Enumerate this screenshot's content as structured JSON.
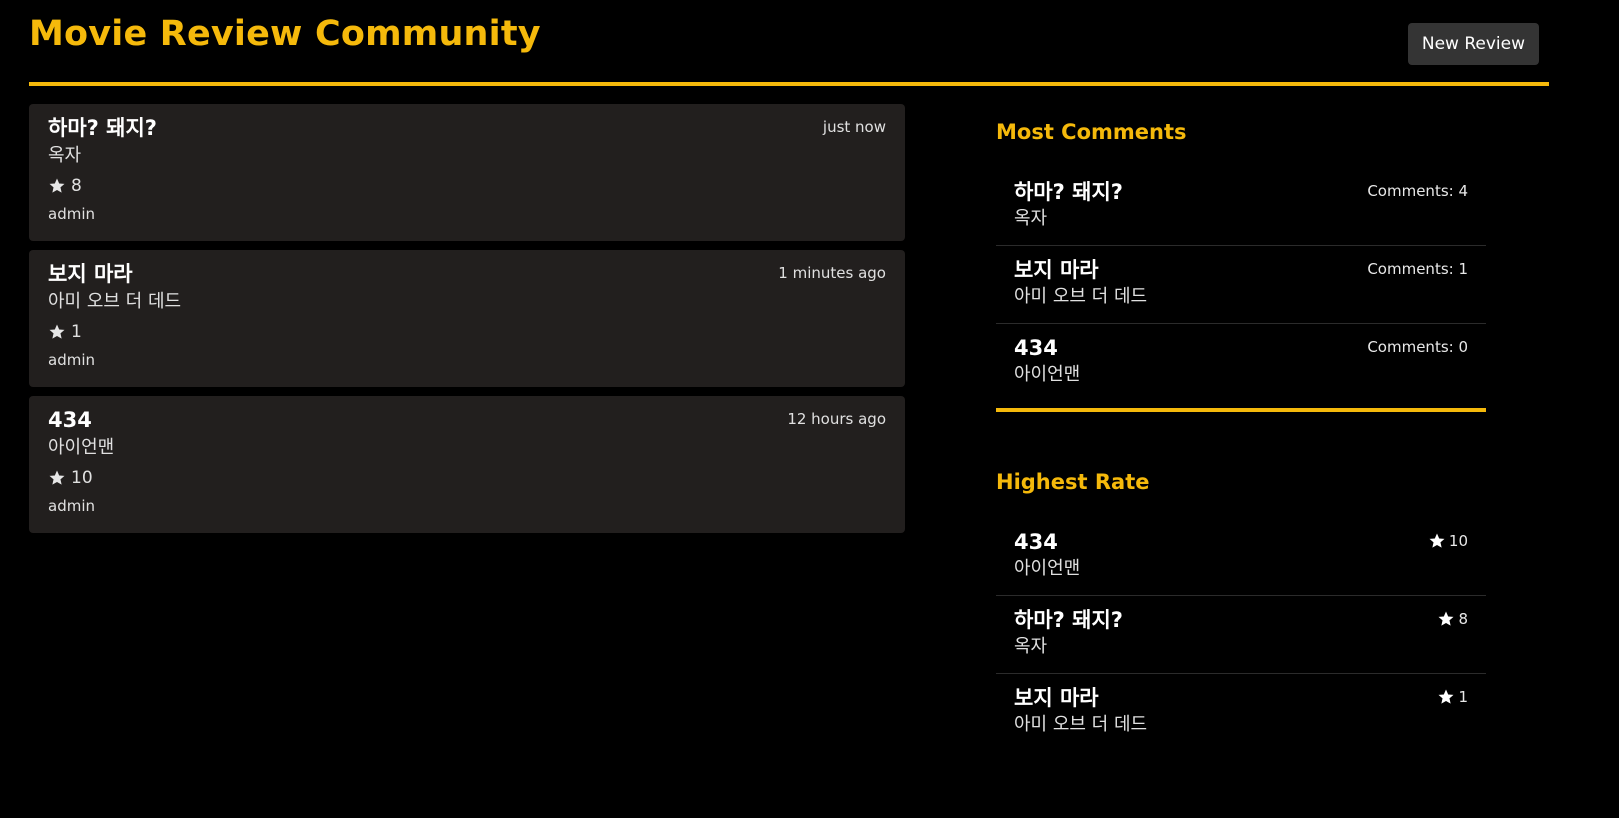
{
  "app": {
    "title": "Movie Review Community",
    "new_review_label": "New Review",
    "accent_color": "#f5b90b"
  },
  "reviews": [
    {
      "title": "하마? 돼지?",
      "movie": "옥자",
      "rating": "8",
      "author": "admin",
      "time": "just now"
    },
    {
      "title": "보지 마라",
      "movie": "아미 오브 더 데드",
      "rating": "1",
      "author": "admin",
      "time": "1 minutes ago"
    },
    {
      "title": "434",
      "movie": "아이언맨",
      "rating": "10",
      "author": "admin",
      "time": "12 hours ago"
    }
  ],
  "most_comments": {
    "title": "Most Comments",
    "items": [
      {
        "title": "하마? 돼지?",
        "movie": "옥자",
        "comments": "Comments: 4"
      },
      {
        "title": "보지 마라",
        "movie": "아미 오브 더 데드",
        "comments": "Comments: 1"
      },
      {
        "title": "434",
        "movie": "아이언맨",
        "comments": "Comments: 0"
      }
    ]
  },
  "highest_rate": {
    "title": "Highest Rate",
    "items": [
      {
        "title": "434",
        "movie": "아이언맨",
        "rating": "10"
      },
      {
        "title": "하마? 돼지?",
        "movie": "옥자",
        "rating": "8"
      },
      {
        "title": "보지 마라",
        "movie": "아미 오브 더 데드",
        "rating": "1"
      }
    ]
  },
  "icons": {
    "rating": "star-icon"
  }
}
